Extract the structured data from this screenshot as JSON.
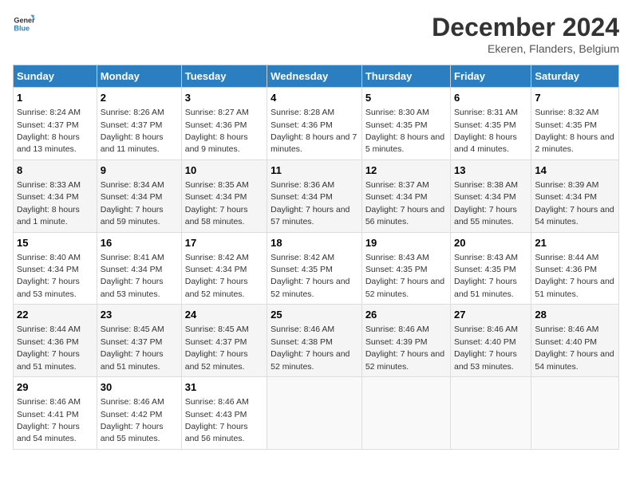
{
  "header": {
    "logo_general": "General",
    "logo_blue": "Blue",
    "title": "December 2024",
    "subtitle": "Ekeren, Flanders, Belgium"
  },
  "weekdays": [
    "Sunday",
    "Monday",
    "Tuesday",
    "Wednesday",
    "Thursday",
    "Friday",
    "Saturday"
  ],
  "weeks": [
    [
      {
        "day": "1",
        "sunrise": "Sunrise: 8:24 AM",
        "sunset": "Sunset: 4:37 PM",
        "daylight": "Daylight: 8 hours and 13 minutes."
      },
      {
        "day": "2",
        "sunrise": "Sunrise: 8:26 AM",
        "sunset": "Sunset: 4:37 PM",
        "daylight": "Daylight: 8 hours and 11 minutes."
      },
      {
        "day": "3",
        "sunrise": "Sunrise: 8:27 AM",
        "sunset": "Sunset: 4:36 PM",
        "daylight": "Daylight: 8 hours and 9 minutes."
      },
      {
        "day": "4",
        "sunrise": "Sunrise: 8:28 AM",
        "sunset": "Sunset: 4:36 PM",
        "daylight": "Daylight: 8 hours and 7 minutes."
      },
      {
        "day": "5",
        "sunrise": "Sunrise: 8:30 AM",
        "sunset": "Sunset: 4:35 PM",
        "daylight": "Daylight: 8 hours and 5 minutes."
      },
      {
        "day": "6",
        "sunrise": "Sunrise: 8:31 AM",
        "sunset": "Sunset: 4:35 PM",
        "daylight": "Daylight: 8 hours and 4 minutes."
      },
      {
        "day": "7",
        "sunrise": "Sunrise: 8:32 AM",
        "sunset": "Sunset: 4:35 PM",
        "daylight": "Daylight: 8 hours and 2 minutes."
      }
    ],
    [
      {
        "day": "8",
        "sunrise": "Sunrise: 8:33 AM",
        "sunset": "Sunset: 4:34 PM",
        "daylight": "Daylight: 8 hours and 1 minute."
      },
      {
        "day": "9",
        "sunrise": "Sunrise: 8:34 AM",
        "sunset": "Sunset: 4:34 PM",
        "daylight": "Daylight: 7 hours and 59 minutes."
      },
      {
        "day": "10",
        "sunrise": "Sunrise: 8:35 AM",
        "sunset": "Sunset: 4:34 PM",
        "daylight": "Daylight: 7 hours and 58 minutes."
      },
      {
        "day": "11",
        "sunrise": "Sunrise: 8:36 AM",
        "sunset": "Sunset: 4:34 PM",
        "daylight": "Daylight: 7 hours and 57 minutes."
      },
      {
        "day": "12",
        "sunrise": "Sunrise: 8:37 AM",
        "sunset": "Sunset: 4:34 PM",
        "daylight": "Daylight: 7 hours and 56 minutes."
      },
      {
        "day": "13",
        "sunrise": "Sunrise: 8:38 AM",
        "sunset": "Sunset: 4:34 PM",
        "daylight": "Daylight: 7 hours and 55 minutes."
      },
      {
        "day": "14",
        "sunrise": "Sunrise: 8:39 AM",
        "sunset": "Sunset: 4:34 PM",
        "daylight": "Daylight: 7 hours and 54 minutes."
      }
    ],
    [
      {
        "day": "15",
        "sunrise": "Sunrise: 8:40 AM",
        "sunset": "Sunset: 4:34 PM",
        "daylight": "Daylight: 7 hours and 53 minutes."
      },
      {
        "day": "16",
        "sunrise": "Sunrise: 8:41 AM",
        "sunset": "Sunset: 4:34 PM",
        "daylight": "Daylight: 7 hours and 53 minutes."
      },
      {
        "day": "17",
        "sunrise": "Sunrise: 8:42 AM",
        "sunset": "Sunset: 4:34 PM",
        "daylight": "Daylight: 7 hours and 52 minutes."
      },
      {
        "day": "18",
        "sunrise": "Sunrise: 8:42 AM",
        "sunset": "Sunset: 4:35 PM",
        "daylight": "Daylight: 7 hours and 52 minutes."
      },
      {
        "day": "19",
        "sunrise": "Sunrise: 8:43 AM",
        "sunset": "Sunset: 4:35 PM",
        "daylight": "Daylight: 7 hours and 52 minutes."
      },
      {
        "day": "20",
        "sunrise": "Sunrise: 8:43 AM",
        "sunset": "Sunset: 4:35 PM",
        "daylight": "Daylight: 7 hours and 51 minutes."
      },
      {
        "day": "21",
        "sunrise": "Sunrise: 8:44 AM",
        "sunset": "Sunset: 4:36 PM",
        "daylight": "Daylight: 7 hours and 51 minutes."
      }
    ],
    [
      {
        "day": "22",
        "sunrise": "Sunrise: 8:44 AM",
        "sunset": "Sunset: 4:36 PM",
        "daylight": "Daylight: 7 hours and 51 minutes."
      },
      {
        "day": "23",
        "sunrise": "Sunrise: 8:45 AM",
        "sunset": "Sunset: 4:37 PM",
        "daylight": "Daylight: 7 hours and 51 minutes."
      },
      {
        "day": "24",
        "sunrise": "Sunrise: 8:45 AM",
        "sunset": "Sunset: 4:37 PM",
        "daylight": "Daylight: 7 hours and 52 minutes."
      },
      {
        "day": "25",
        "sunrise": "Sunrise: 8:46 AM",
        "sunset": "Sunset: 4:38 PM",
        "daylight": "Daylight: 7 hours and 52 minutes."
      },
      {
        "day": "26",
        "sunrise": "Sunrise: 8:46 AM",
        "sunset": "Sunset: 4:39 PM",
        "daylight": "Daylight: 7 hours and 52 minutes."
      },
      {
        "day": "27",
        "sunrise": "Sunrise: 8:46 AM",
        "sunset": "Sunset: 4:40 PM",
        "daylight": "Daylight: 7 hours and 53 minutes."
      },
      {
        "day": "28",
        "sunrise": "Sunrise: 8:46 AM",
        "sunset": "Sunset: 4:40 PM",
        "daylight": "Daylight: 7 hours and 54 minutes."
      }
    ],
    [
      {
        "day": "29",
        "sunrise": "Sunrise: 8:46 AM",
        "sunset": "Sunset: 4:41 PM",
        "daylight": "Daylight: 7 hours and 54 minutes."
      },
      {
        "day": "30",
        "sunrise": "Sunrise: 8:46 AM",
        "sunset": "Sunset: 4:42 PM",
        "daylight": "Daylight: 7 hours and 55 minutes."
      },
      {
        "day": "31",
        "sunrise": "Sunrise: 8:46 AM",
        "sunset": "Sunset: 4:43 PM",
        "daylight": "Daylight: 7 hours and 56 minutes."
      },
      null,
      null,
      null,
      null
    ]
  ]
}
